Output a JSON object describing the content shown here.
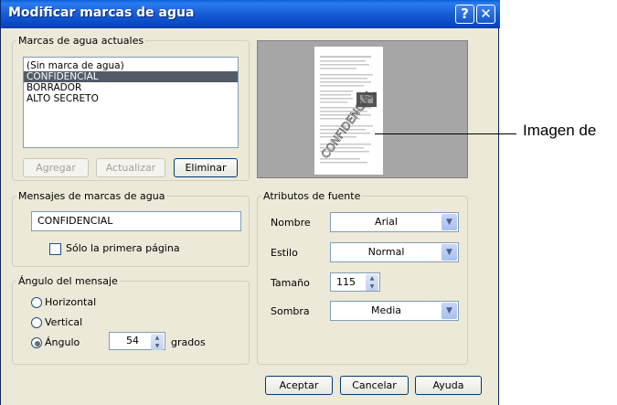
{
  "window": {
    "title": "Modificar marcas de agua",
    "help_glyph": "?",
    "close_glyph": "✕"
  },
  "current_watermarks": {
    "legend": "Marcas de agua actuales",
    "items": [
      "(Sin marca de agua)",
      "CONFIDENCIAL",
      "BORRADOR",
      "ALTO SECRETO"
    ],
    "selected_index": 1,
    "add_label": "Agregar",
    "update_label": "Actualizar",
    "delete_label": "Eliminar"
  },
  "preview": {
    "watermark_text": "CONFIDENCIAL",
    "angle": 54
  },
  "messages": {
    "legend": "Mensajes de marcas de agua",
    "text_value": "CONFIDENCIAL",
    "first_page_only_label": "Sólo la primera página",
    "first_page_only_checked": false
  },
  "angle": {
    "legend": "Ángulo del mensaje",
    "horizontal_label": "Horizontal",
    "vertical_label": "Vertical",
    "angle_label": "Ángulo",
    "value": "54",
    "unit_label": "grados",
    "selected": "angle"
  },
  "font": {
    "legend": "Atributos de fuente",
    "name_label": "Nombre",
    "name_value": "Arial",
    "style_label": "Estilo",
    "style_value": "Normal",
    "size_label": "Tamaño",
    "size_value": "115",
    "shadow_label": "Sombra",
    "shadow_value": "Media"
  },
  "footer": {
    "ok_label": "Aceptar",
    "cancel_label": "Cancelar",
    "help_label": "Ayuda"
  },
  "callout": {
    "text": "Imagen de"
  },
  "colors": {
    "titlebar": "#0a5fd8",
    "dialog_bg": "#ece9d8",
    "selection": "#525b66"
  }
}
